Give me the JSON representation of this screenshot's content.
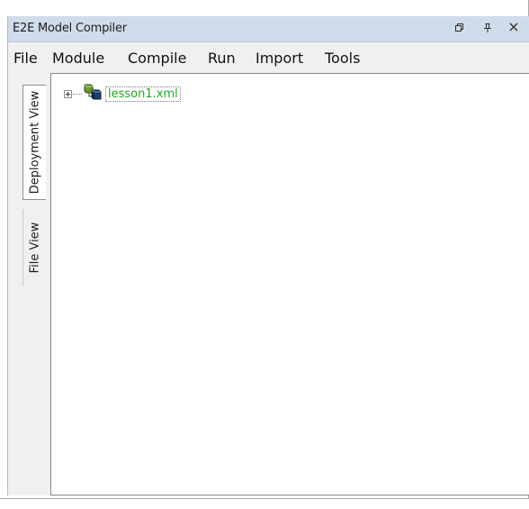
{
  "window": {
    "title": "E2E Model Compiler"
  },
  "titlebar_buttons": [
    {
      "name": "restore-icon",
      "label": ""
    },
    {
      "name": "pin-icon",
      "label": ""
    },
    {
      "name": "close-icon",
      "label": "×"
    }
  ],
  "menu": {
    "items": [
      {
        "label": "File"
      },
      {
        "label": "Module"
      },
      {
        "label": "Compile"
      },
      {
        "label": "Run"
      },
      {
        "label": "Import"
      },
      {
        "label": "Tools"
      }
    ]
  },
  "side_tabs": [
    {
      "label": "Deployment View",
      "active": true
    },
    {
      "label": "File View",
      "active": false
    }
  ],
  "tree": {
    "root": {
      "label": "lesson1.xml",
      "icon": "module-icon",
      "expanded": false,
      "label_color": "#22aa22"
    }
  }
}
